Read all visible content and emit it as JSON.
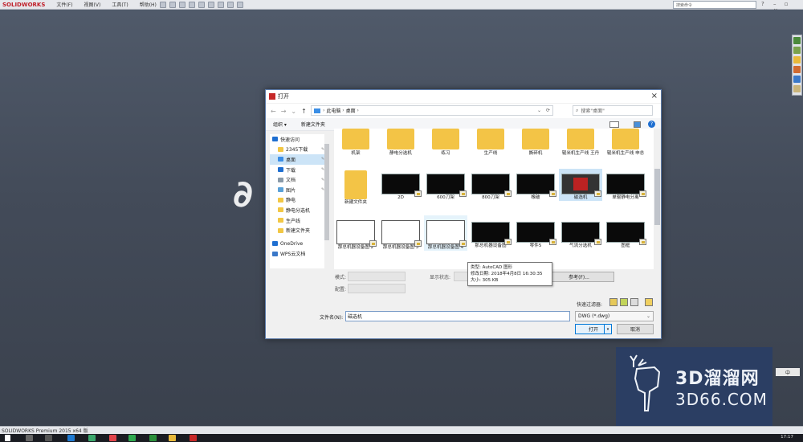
{
  "app": {
    "brand": "SOLIDWORKS",
    "menus": [
      "文件(F)",
      "视图(V)",
      "工具(T)",
      "帮助(H)"
    ],
    "search_placeholder": "搜索命令",
    "status": "SOLIDWORKS Premium 2015 x64 版",
    "clock": "17:17",
    "ime": "中"
  },
  "dialog": {
    "title": "打开",
    "breadcrumb": [
      "此电脑",
      "桌面"
    ],
    "search_placeholder": "搜索\"桌面\"",
    "organize": "组织 ▾",
    "new_folder": "新建文件夹",
    "nav_items": [
      {
        "label": "快速访问",
        "icon": "star"
      },
      {
        "label": "2345下载",
        "icon": "folder",
        "pin": true
      },
      {
        "label": "桌面",
        "icon": "desktop",
        "pin": true,
        "selected": true
      },
      {
        "label": "下载",
        "icon": "download",
        "pin": true
      },
      {
        "label": "文档",
        "icon": "doc",
        "pin": true
      },
      {
        "label": "图片",
        "icon": "pic",
        "pin": true
      },
      {
        "label": "静电",
        "icon": "folder"
      },
      {
        "label": "静电分选机",
        "icon": "folder"
      },
      {
        "label": "生产线",
        "icon": "folder"
      },
      {
        "label": "新建文件夹",
        "icon": "folder"
      },
      {
        "label": "OneDrive",
        "icon": "cloud"
      },
      {
        "label": "WPS云文档",
        "icon": "wps"
      }
    ],
    "files": [
      {
        "label": "机架",
        "kind": "folder"
      },
      {
        "label": "静电分选机",
        "kind": "folder"
      },
      {
        "label": "练习",
        "kind": "folder"
      },
      {
        "label": "生产线",
        "kind": "folder"
      },
      {
        "label": "撕碎机",
        "kind": "folder"
      },
      {
        "label": "辊米机生产线 王丹",
        "kind": "folder"
      },
      {
        "label": "辊米机生产线 申总",
        "kind": "folder"
      },
      {
        "label": "新建文件夹",
        "kind": "folder"
      },
      {
        "label": "2D",
        "kind": "cad"
      },
      {
        "label": "600刀架",
        "kind": "cad"
      },
      {
        "label": "800刀架",
        "kind": "cad"
      },
      {
        "label": "橡破",
        "kind": "cad"
      },
      {
        "label": "磁选机",
        "kind": "cad",
        "selected": true
      },
      {
        "label": "单辊静电分离",
        "kind": "cad"
      },
      {
        "label": "那总机器设备图 2",
        "kind": "cadw"
      },
      {
        "label": "那总机器设备图 3",
        "kind": "cadw"
      },
      {
        "label": "那总机器设备图 4",
        "kind": "cadw",
        "hover": true
      },
      {
        "label": "那总机器设备图",
        "kind": "cad"
      },
      {
        "label": "零件5",
        "kind": "cad"
      },
      {
        "label": "气流分选机",
        "kind": "cad"
      },
      {
        "label": "图框",
        "kind": "cad"
      }
    ],
    "tooltip": [
      "类型: AutoCAD 图形",
      "修改日期: 2018年4月8日 16:30:35",
      "大小: 305 KB"
    ],
    "mode_label": "模式:",
    "config_label": "配置:",
    "display_state_label": "显示状态:",
    "references_button": "参考(F)...",
    "quick_filter_label": "快速过滤器:",
    "filename_label": "文件名(N):",
    "filename_value": "磁选机",
    "filetype_value": "DWG (*.dwg)",
    "open_button": "打开",
    "cancel_button": "取消"
  },
  "watermark": {
    "line1": "3D溜溜网",
    "line2": "3D66.COM"
  },
  "colors": {
    "accent": "#0078d7",
    "folder": "#f3c446",
    "dialog_border": "#5b7aa8"
  }
}
